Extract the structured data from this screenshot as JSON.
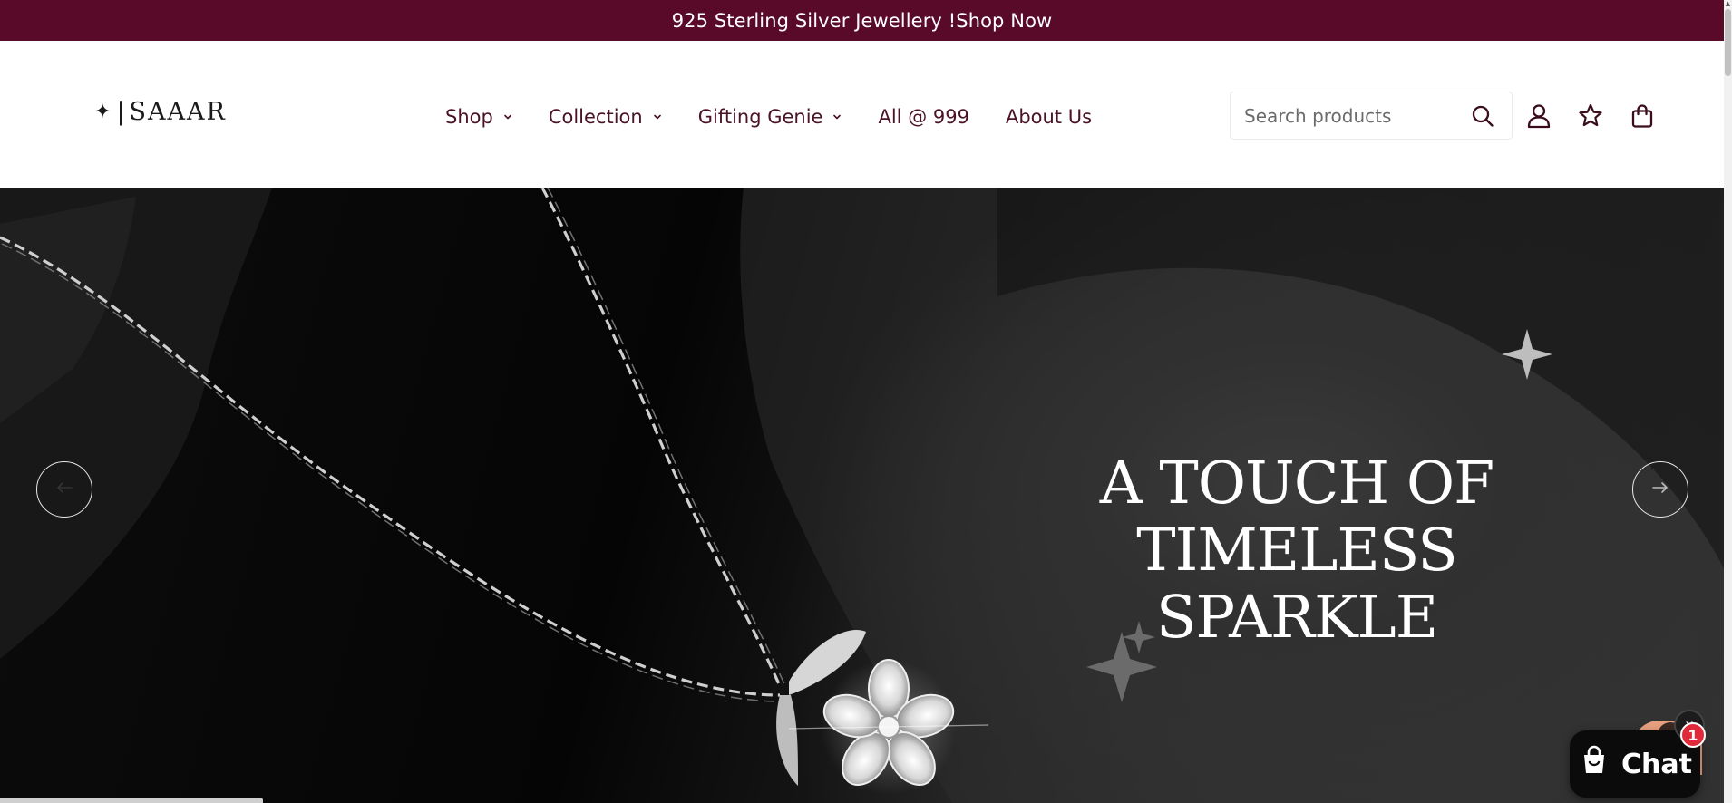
{
  "announcement": {
    "text": "925 Sterling Silver Jewellery !",
    "link": "Shop Now"
  },
  "header": {
    "logo": {
      "mark": "✦",
      "separator": "|",
      "text": "SAAAR"
    },
    "nav": [
      {
        "label": "Shop",
        "has_dropdown": true
      },
      {
        "label": "Collection",
        "has_dropdown": true
      },
      {
        "label": "Gifting Genie",
        "has_dropdown": true
      },
      {
        "label": "All @ 999",
        "has_dropdown": false
      },
      {
        "label": "About Us",
        "has_dropdown": false
      }
    ],
    "search": {
      "placeholder": "Search products",
      "value": ""
    },
    "icons": [
      "search-icon",
      "account-icon",
      "wishlist-star-icon",
      "cart-bag-icon"
    ]
  },
  "hero": {
    "title_line1": "A TOUCH OF TIMELESS",
    "title_line2": "SPARKLE",
    "prev_icon": "arrow-left-icon",
    "next_icon": "arrow-right-icon"
  },
  "chat": {
    "label": "Chat",
    "badge_count": "1",
    "close_label": "x"
  },
  "colors": {
    "announcement_bg": "#580a28",
    "nav_text": "#4a1326",
    "chat_bg": "#0b0b0b",
    "badge_bg": "#e02a3a"
  }
}
